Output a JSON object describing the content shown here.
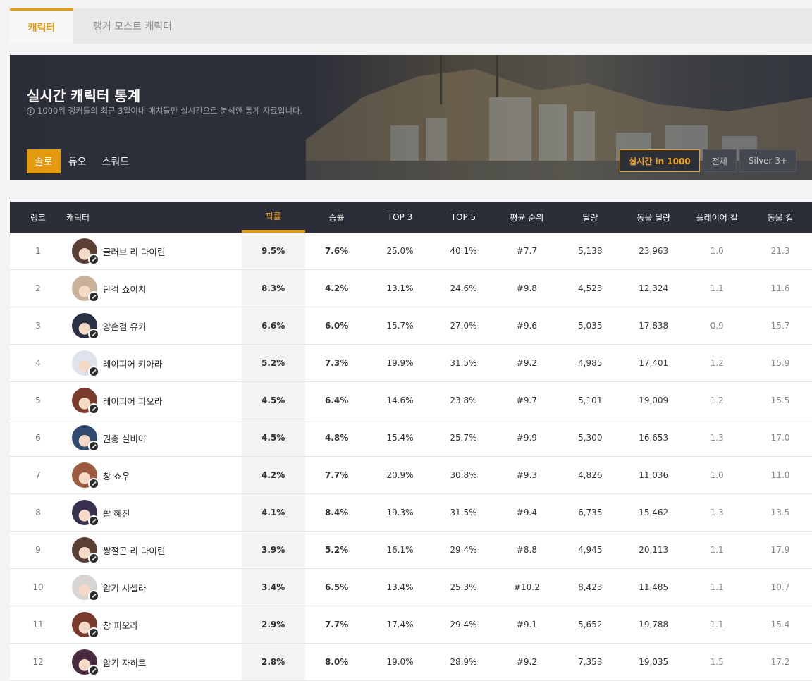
{
  "tabs": [
    {
      "label": "캐릭터",
      "active": true
    },
    {
      "label": "랭커 모스트 캐릭터",
      "active": false
    }
  ],
  "hero": {
    "title": "실시간 캐릭터 통계",
    "subtitle": "1000위 랭커들의 최근 3일이내 매치들만 실시간으로 분석한 통계 자료입니다.",
    "info_icon": "info-icon",
    "modes": [
      {
        "label": "솔로",
        "active": true
      },
      {
        "label": "듀오",
        "active": false
      },
      {
        "label": "스쿼드",
        "active": false
      }
    ],
    "filters": [
      {
        "label": "실시간 in 1000",
        "active": true
      },
      {
        "label": "전체",
        "active": false
      },
      {
        "label": "Silver 3+",
        "active": false
      }
    ]
  },
  "colors": {
    "accent": "#e59a0d",
    "header_bg": "#2b2e38"
  },
  "table": {
    "headers": [
      "랭크",
      "캐릭터",
      "픽률",
      "승률",
      "TOP 3",
      "TOP 5",
      "평균 순위",
      "딜량",
      "동물 딜량",
      "플레이어 킬",
      "동물 킬"
    ],
    "sorted_by": "픽률",
    "rows": [
      {
        "rank": "1",
        "name": "글러브 리 다이린",
        "pick": "9.5%",
        "win": "7.6%",
        "top3": "25.0%",
        "top5": "40.1%",
        "avg": "#7.7",
        "dmg": "5,138",
        "animal_dmg": "23,963",
        "pk": "1.0",
        "ak": "21.3",
        "avatar_color": "#5a4034"
      },
      {
        "rank": "2",
        "name": "단검 쇼이치",
        "pick": "8.3%",
        "win": "4.2%",
        "top3": "13.1%",
        "top5": "24.6%",
        "avg": "#9.8",
        "dmg": "4,523",
        "animal_dmg": "12,324",
        "pk": "1.1",
        "ak": "11.6",
        "avatar_color": "#c9b19a"
      },
      {
        "rank": "3",
        "name": "양손검 유키",
        "pick": "6.6%",
        "win": "6.0%",
        "top3": "15.7%",
        "top5": "27.0%",
        "avg": "#9.6",
        "dmg": "5,035",
        "animal_dmg": "17,838",
        "pk": "0.9",
        "ak": "15.7",
        "avatar_color": "#2c3044"
      },
      {
        "rank": "4",
        "name": "레이피어 키아라",
        "pick": "5.2%",
        "win": "7.3%",
        "top3": "19.9%",
        "top5": "31.5%",
        "avg": "#9.2",
        "dmg": "4,985",
        "animal_dmg": "17,401",
        "pk": "1.2",
        "ak": "15.9",
        "avatar_color": "#dfe3ec"
      },
      {
        "rank": "5",
        "name": "레이피어 피오라",
        "pick": "4.5%",
        "win": "6.4%",
        "top3": "14.6%",
        "top5": "23.8%",
        "avg": "#9.7",
        "dmg": "5,101",
        "animal_dmg": "19,009",
        "pk": "1.2",
        "ak": "15.5",
        "avatar_color": "#7a3a2c"
      },
      {
        "rank": "6",
        "name": "권총 실비아",
        "pick": "4.5%",
        "win": "4.8%",
        "top3": "15.4%",
        "top5": "25.7%",
        "avg": "#9.9",
        "dmg": "5,300",
        "animal_dmg": "16,653",
        "pk": "1.3",
        "ak": "17.0",
        "avatar_color": "#2f4a6e"
      },
      {
        "rank": "7",
        "name": "창 쇼우",
        "pick": "4.2%",
        "win": "7.7%",
        "top3": "20.9%",
        "top5": "30.8%",
        "avg": "#9.3",
        "dmg": "4,826",
        "animal_dmg": "11,036",
        "pk": "1.0",
        "ak": "11.0",
        "avatar_color": "#9c5a3e"
      },
      {
        "rank": "8",
        "name": "활 혜진",
        "pick": "4.1%",
        "win": "8.4%",
        "top3": "19.3%",
        "top5": "31.5%",
        "avg": "#9.4",
        "dmg": "6,735",
        "animal_dmg": "15,462",
        "pk": "1.3",
        "ak": "13.5",
        "avatar_color": "#3a3050"
      },
      {
        "rank": "9",
        "name": "쌍절곤 리 다이린",
        "pick": "3.9%",
        "win": "5.2%",
        "top3": "16.1%",
        "top5": "29.4%",
        "avg": "#8.8",
        "dmg": "4,945",
        "animal_dmg": "20,113",
        "pk": "1.1",
        "ak": "17.9",
        "avatar_color": "#5a4034"
      },
      {
        "rank": "10",
        "name": "암기 시셀라",
        "pick": "3.4%",
        "win": "6.5%",
        "top3": "13.4%",
        "top5": "25.3%",
        "avg": "#10.2",
        "dmg": "8,423",
        "animal_dmg": "11,485",
        "pk": "1.1",
        "ak": "10.7",
        "avatar_color": "#d8d4d2"
      },
      {
        "rank": "11",
        "name": "창 피오라",
        "pick": "2.9%",
        "win": "7.7%",
        "top3": "17.4%",
        "top5": "29.4%",
        "avg": "#9.1",
        "dmg": "5,652",
        "animal_dmg": "19,788",
        "pk": "1.1",
        "ak": "15.4",
        "avatar_color": "#7a3a2c"
      },
      {
        "rank": "12",
        "name": "암기 자히르",
        "pick": "2.8%",
        "win": "8.0%",
        "top3": "19.0%",
        "top5": "28.9%",
        "avg": "#9.2",
        "dmg": "7,353",
        "animal_dmg": "19,035",
        "pk": "1.5",
        "ak": "17.2",
        "avatar_color": "#4a2a40"
      }
    ]
  }
}
